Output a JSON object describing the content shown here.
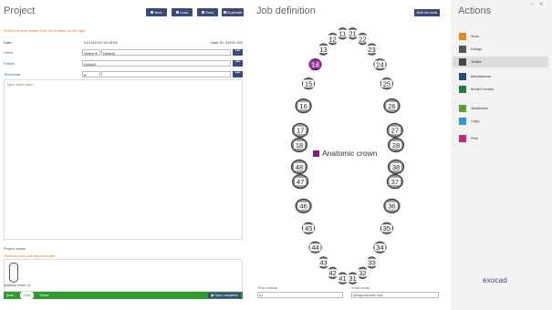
{
  "project": {
    "title": "Project",
    "toolbar": [
      "New",
      "Load",
      "Save",
      "Duplicate"
    ],
    "hint": "Select the next action from the buttons on the right",
    "date_label": "Date",
    "date_value": "21/10/2019 15:18:54",
    "case_label": "Case ID: 20191-000",
    "client_label": "Client",
    "client_value": "Default",
    "patient_label": "Patient",
    "patient_value": "Default",
    "technician_label": "Technician",
    "technician_value": "",
    "notes_placeholder": "Type notes here...",
    "status_title": "Project status",
    "status_sub": "Selected only one tooth number",
    "tooth_label": "Anatomy crown 14",
    "progress": [
      "Scan",
      "CAD",
      "Model"
    ],
    "open_button": "Open completed"
  },
  "job": {
    "title": "Job definition",
    "multi_button": "Multi die mode",
    "legend": "Anatomic crown",
    "legend_color": "#8a1a8a",
    "selected_tooth": "14",
    "upper_teeth": [
      "18",
      "17",
      "16",
      "15",
      "14",
      "13",
      "12",
      "11",
      "21",
      "22",
      "23",
      "24",
      "25",
      "26",
      "27",
      "28"
    ],
    "lower_teeth": [
      "48",
      "47",
      "46",
      "45",
      "44",
      "43",
      "42",
      "41",
      "31",
      "32",
      "33",
      "34",
      "35",
      "36",
      "37",
      "38"
    ],
    "bottom_left_label": "Tooth shade",
    "bottom_left_value": "A1",
    "bottom_right_label": "Scan mode",
    "bottom_right_value": "Antagonist scan only"
  },
  "actions": {
    "title": "Actions",
    "items": [
      {
        "label": "Scan",
        "color": "#e08a1a"
      },
      {
        "label": "Design",
        "color": "#555"
      },
      {
        "label": "Toolkit",
        "color": "#444"
      },
      {
        "label": "Manufacture",
        "color": "#2a4a7a"
      },
      {
        "label": "Model Creator",
        "color": "#2a7a3a"
      },
      {
        "label": "JawMotion",
        "color": "#5aa02a"
      },
      {
        "label": "Copy",
        "color": "#2a9ad0"
      },
      {
        "label": "Print",
        "color": "#c02a7a"
      }
    ],
    "brand": "exocad"
  }
}
